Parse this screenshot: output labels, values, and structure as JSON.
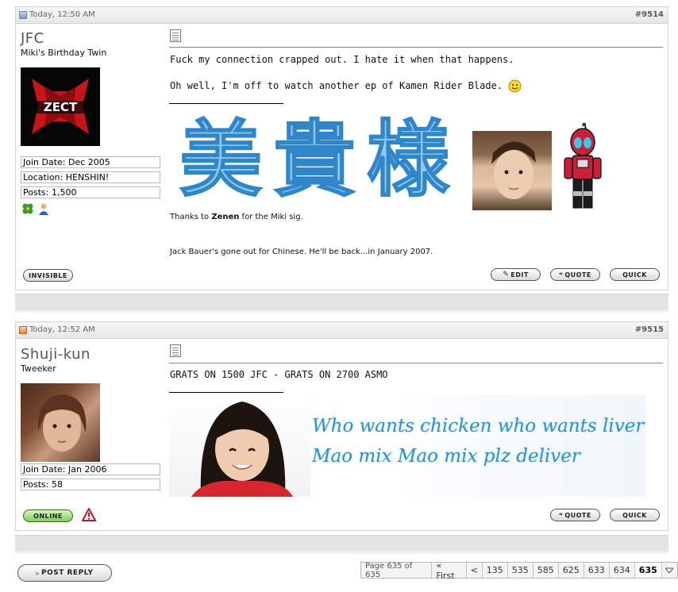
{
  "posts": [
    {
      "date": "Today, 12:50 AM",
      "number": "#9514",
      "username": "JFC",
      "user_title": "Miki's Birthday Twin",
      "avatar_text": "ZECT",
      "info": [
        "Join Date: Dec 2005",
        "Location: HENSHIN!",
        "Posts: 1,500"
      ],
      "message": [
        "Fuck my connection crapped out. I hate it when that happens.",
        "Oh well, I'm off to watch another ep of Kamen Rider Blade."
      ],
      "sig_kanji": "美貴様",
      "sig_credit_pre": "Thanks to ",
      "sig_credit_name": "Zenen",
      "sig_credit_post": " for the Miki sig.",
      "sig_note": "Jack Bauer's gone out for Chinese. He'll be back...in January 2007.",
      "status_button": "INVISIBLE",
      "buttons": [
        "EDIT",
        "QUOTE",
        "QUICK"
      ]
    },
    {
      "date": "Today, 12:52 AM",
      "number": "#9515",
      "username": "Shuji-kun",
      "user_title": "Tweeker",
      "info": [
        "Join Date: Jan 2006",
        "Posts: 58"
      ],
      "message": [
        "GRATS ON 1500 JFC - GRATS ON 2700 ASMO"
      ],
      "sig_lines": [
        "Who wants chicken who wants liver",
        "Mao mix Mao mix plz deliver"
      ],
      "status_button": "ONLINE",
      "buttons": [
        "QUOTE",
        "QUICK"
      ]
    }
  ],
  "post_reply": "POST REPLY",
  "pagenav": {
    "label": "Page 635 of 635",
    "first": "« First",
    "prev": "<",
    "pages": [
      "135",
      "535",
      "585",
      "625",
      "633",
      "634"
    ],
    "current": "635"
  },
  "colors": {
    "header_bg": "#eeeeee",
    "border": "#d4d4d4",
    "sig_text": "#2f8fc8"
  }
}
